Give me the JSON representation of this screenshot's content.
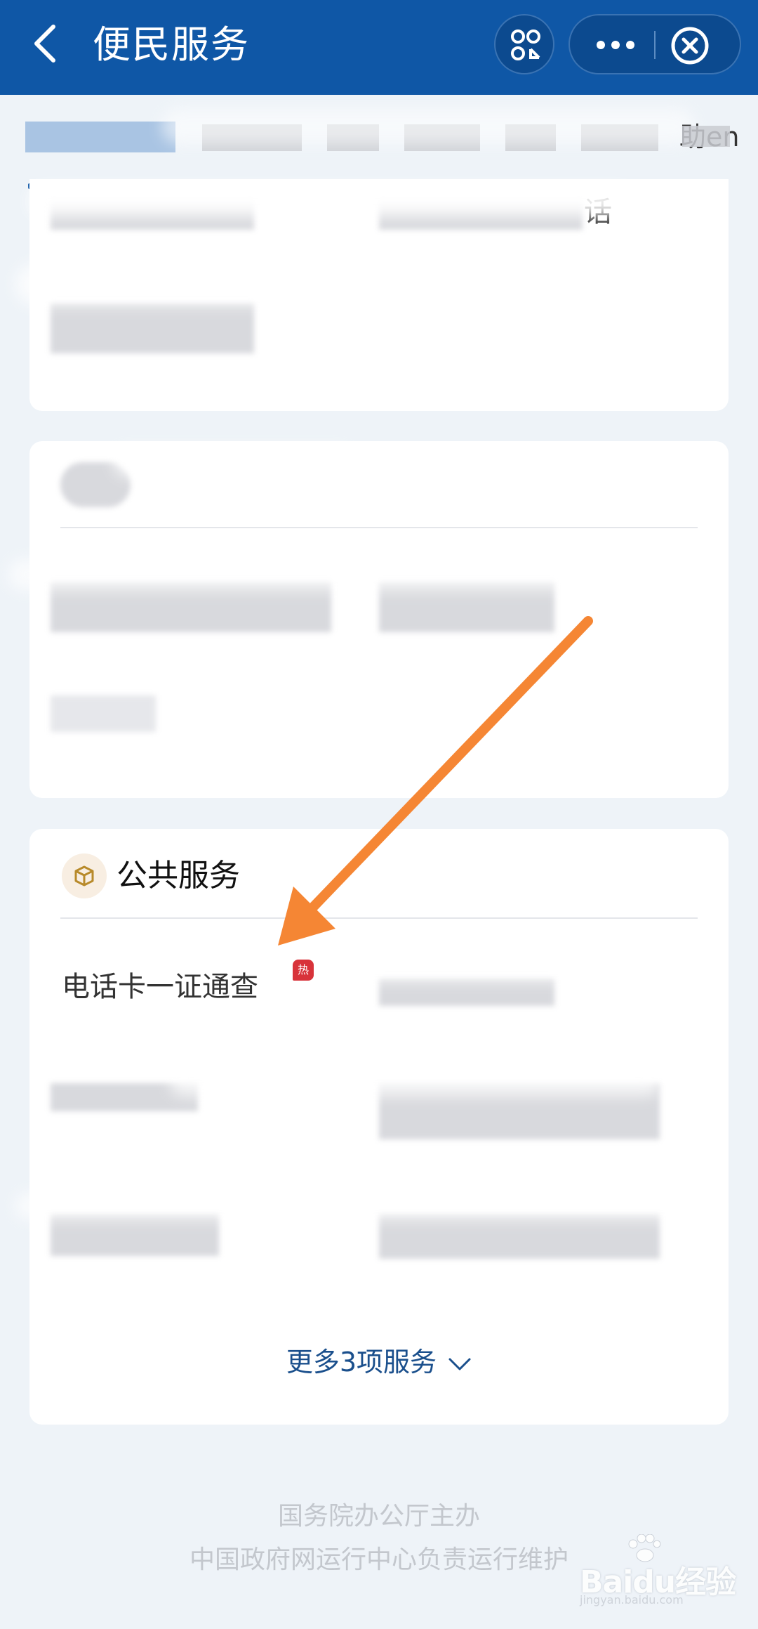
{
  "header": {
    "title": "便民服务",
    "back_icon": "chevron-left-icon",
    "scan_icon": "scan-icon",
    "more_icon": "ellipsis-icon",
    "close_icon": "close-circle-icon"
  },
  "tabs": {
    "right_partial_label": "助en"
  },
  "cards": {
    "card1": {
      "partial_text": "话"
    },
    "public_service": {
      "title": "公共服务",
      "icon": "box-icon",
      "featured_item": {
        "label": "电话卡一证通查",
        "badge": "热"
      },
      "partial_bottom_left": "[被遮挡]",
      "more_link": "更多3项服务"
    }
  },
  "footer": {
    "line1": "国务院办公厅主办",
    "line2": "中国政府网运行中心负责运行维护"
  },
  "watermark": {
    "logo": "Baidu经验",
    "url": "jingyan.baidu.com"
  },
  "colors": {
    "header_bg": "#0f57a6",
    "page_bg": "#eef3f8",
    "accent_arrow": "#f58634",
    "badge_red": "#d8333a",
    "link_blue": "#1a4f8c"
  }
}
